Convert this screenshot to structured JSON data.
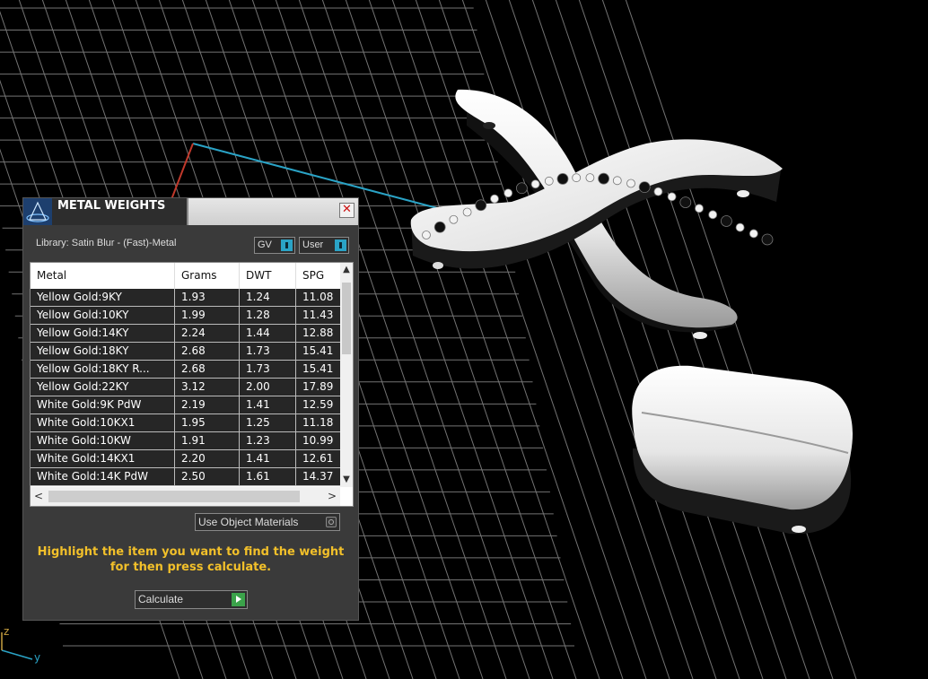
{
  "window": {
    "title": "METAL WEIGHTS",
    "close_glyph": "✕"
  },
  "library": {
    "label": "Library: Satin Blur - (Fast)-Metal"
  },
  "toggles": {
    "gv_label": "GV",
    "user_label": "User"
  },
  "table": {
    "headers": [
      "Metal",
      "Grams",
      "DWT",
      "SPG"
    ],
    "rows": [
      [
        "Yellow Gold:9KY",
        "1.93",
        "1.24",
        "11.08"
      ],
      [
        "Yellow Gold:10KY",
        "1.99",
        "1.28",
        "11.43"
      ],
      [
        "Yellow Gold:14KY",
        "2.24",
        "1.44",
        "12.88"
      ],
      [
        "Yellow Gold:18KY",
        "2.68",
        "1.73",
        "15.41"
      ],
      [
        "Yellow Gold:18KY R...",
        "2.68",
        "1.73",
        "15.41"
      ],
      [
        "Yellow Gold:22KY",
        "3.12",
        "2.00",
        "17.89"
      ],
      [
        "White Gold:9K PdW",
        "2.19",
        "1.41",
        "12.59"
      ],
      [
        "White Gold:10KX1",
        "1.95",
        "1.25",
        "11.18"
      ],
      [
        "White Gold:10KW",
        "1.91",
        "1.23",
        "10.99"
      ],
      [
        "White Gold:14KX1",
        "2.20",
        "1.41",
        "12.61"
      ],
      [
        "White Gold:14K PdW",
        "2.50",
        "1.61",
        "14.37"
      ]
    ]
  },
  "options": {
    "use_object_materials": "Use Object Materials"
  },
  "hint": {
    "line1": "Highlight the item you want to find the weight",
    "line2": "for then press calculate."
  },
  "buttons": {
    "calculate": "Calculate"
  },
  "axes": {
    "z": "z",
    "y": "y"
  },
  "colors": {
    "accent": "#2aa3c6",
    "hint": "#f2c02a",
    "go": "#3ba34a"
  }
}
